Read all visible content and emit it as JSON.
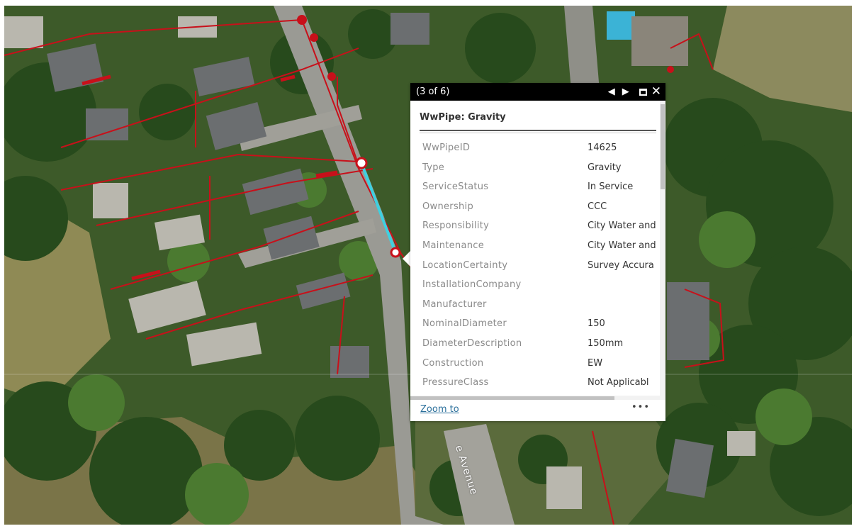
{
  "popup": {
    "count": "(3 of 6)",
    "title": "WwPipe: Gravity",
    "attributes": [
      {
        "key": "WwPipeID",
        "value": "14625"
      },
      {
        "key": "Type",
        "value": "Gravity"
      },
      {
        "key": "ServiceStatus",
        "value": "In Service"
      },
      {
        "key": "Ownership",
        "value": "CCC"
      },
      {
        "key": "Responsibility",
        "value": "City Water and"
      },
      {
        "key": "Maintenance",
        "value": "City Water and"
      },
      {
        "key": "LocationCertainty",
        "value": "Survey Accura"
      },
      {
        "key": "InstallationCompany",
        "value": ""
      },
      {
        "key": "Manufacturer",
        "value": ""
      },
      {
        "key": "NominalDiameter",
        "value": "150"
      },
      {
        "key": "DiameterDescription",
        "value": "150mm"
      },
      {
        "key": "Construction",
        "value": "EW"
      },
      {
        "key": "PressureClass",
        "value": "Not Applicabl"
      }
    ],
    "zoom_label": "Zoom to",
    "more_label": "•••",
    "prev_icon": "◀",
    "next_icon": "▶",
    "close_icon": "✕"
  },
  "map": {
    "street_label": "e Avenue",
    "colors": {
      "pipe": "#c8101a",
      "selected_pipe": "#3fd0e0",
      "vegetation": "#3f5a2c"
    }
  }
}
